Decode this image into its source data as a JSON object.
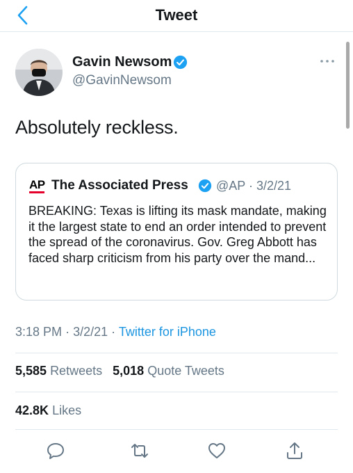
{
  "header": {
    "title": "Tweet"
  },
  "tweet": {
    "author_name": "Gavin Newsom",
    "author_handle": "@GavinNewsom",
    "text": "Absolutely reckless.",
    "time": "3:18 PM",
    "date": "3/2/21",
    "separator": "·",
    "source": "Twitter for iPhone"
  },
  "quote": {
    "logo_text": "AP",
    "author_name": "The Associated Press",
    "author_handle": "@AP",
    "date": "3/2/21",
    "text": "BREAKING: Texas is lifting its mask mandate, making it the largest state to end an order intended to prevent the spread of the coronavirus. Gov. Greg Abbott has faced sharp criticism from his party over the mand..."
  },
  "stats": {
    "retweets_count": "5,585",
    "retweets_label": "Retweets",
    "quotes_count": "5,018",
    "quotes_label": "Quote Tweets",
    "likes_count": "42.8K",
    "likes_label": "Likes"
  },
  "icons": {
    "back": "chevron-left-icon",
    "verified": "verified-badge-icon",
    "more": "more-dots-icon",
    "reply": "reply-icon",
    "retweet": "retweet-icon",
    "like": "heart-icon",
    "share": "share-icon"
  },
  "colors": {
    "accent": "#1b95e0",
    "verified": "#1da1f2",
    "text_primary": "#14171a",
    "text_secondary": "#657786",
    "divider": "#e1e8ed",
    "ap_red": "#e4002b"
  }
}
